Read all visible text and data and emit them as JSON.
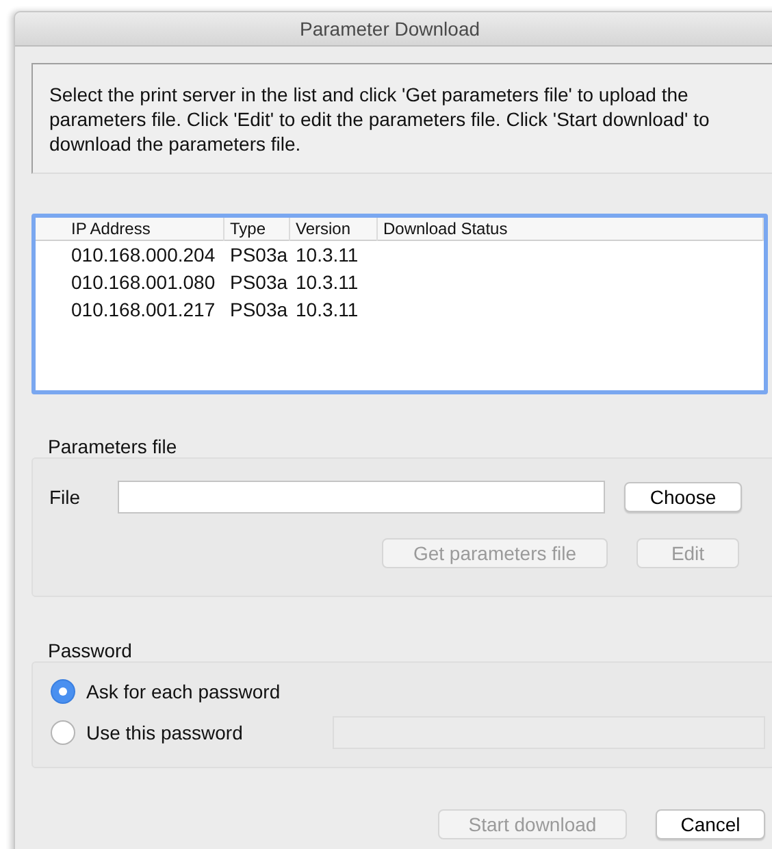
{
  "window": {
    "title": "Parameter Download"
  },
  "instructions": "Select the print server in the list and click 'Get parameters file' to upload the parameters file. Click 'Edit' to edit the parameters file. Click 'Start download' to download the parameters file.",
  "table": {
    "columns": [
      "IP Address",
      "Type",
      "Version",
      "Download Status"
    ],
    "rows": [
      {
        "cells": [
          "010.168.000.204",
          "PS03a",
          "10.3.11"
        ],
        "selected": false
      },
      {
        "cells": [
          "010.168.001.080",
          "PS03a",
          "10.3.11"
        ],
        "selected": false
      },
      {
        "cells": [
          "010.168.001.217",
          "PS03a",
          "10.3.11"
        ],
        "selected": false
      }
    ]
  },
  "parameters_file": {
    "title": "Parameters file",
    "file_label": "File",
    "buttons": [
      {
        "label": "Choose",
        "disabled": false
      },
      {
        "label": "Get parameters file",
        "disabled": true
      },
      {
        "label": "Edit",
        "disabled": true
      }
    ]
  },
  "password": {
    "title": "Password",
    "options": [
      {
        "label": "Ask for each password",
        "selected": true
      },
      {
        "label": "Use this password",
        "selected": false
      }
    ],
    "field_disabled": true
  },
  "buttons": [
    {
      "label": "Start download",
      "disabled": true
    },
    {
      "label": "Cancel",
      "disabled": false
    }
  ]
}
